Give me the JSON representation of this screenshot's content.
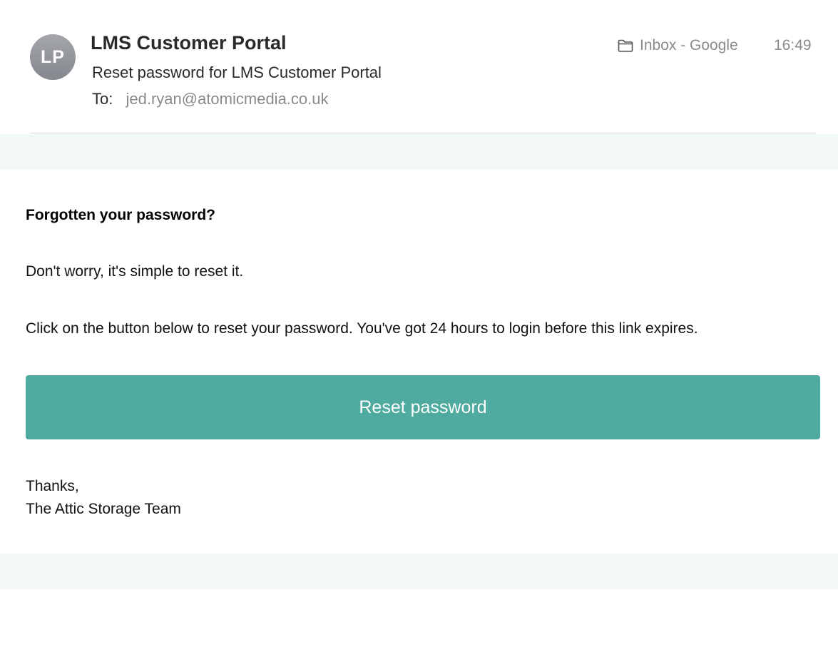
{
  "header": {
    "avatar_initials": "LP",
    "sender_name": "LMS Customer Portal",
    "subject": "Reset password for LMS Customer Portal",
    "to_label": "To:",
    "to_address": "jed.ryan@atomicmedia.co.uk",
    "mailbox": "Inbox - Google",
    "mailbox_icon": "folder-icon",
    "time": "16:49"
  },
  "body": {
    "heading": "Forgotten your password?",
    "paragraph_1": "Don't worry, it's simple to reset it.",
    "paragraph_2": "Click on the button below to reset your password. You've got 24 hours to login before this link expires.",
    "button_label": "Reset password",
    "signoff_line_1": "Thanks,",
    "signoff_line_2": "The Attic Storage Team"
  },
  "colors": {
    "accent": "#4faaa0",
    "band": "#f1f8f7",
    "muted_text": "#8a8a8a"
  }
}
